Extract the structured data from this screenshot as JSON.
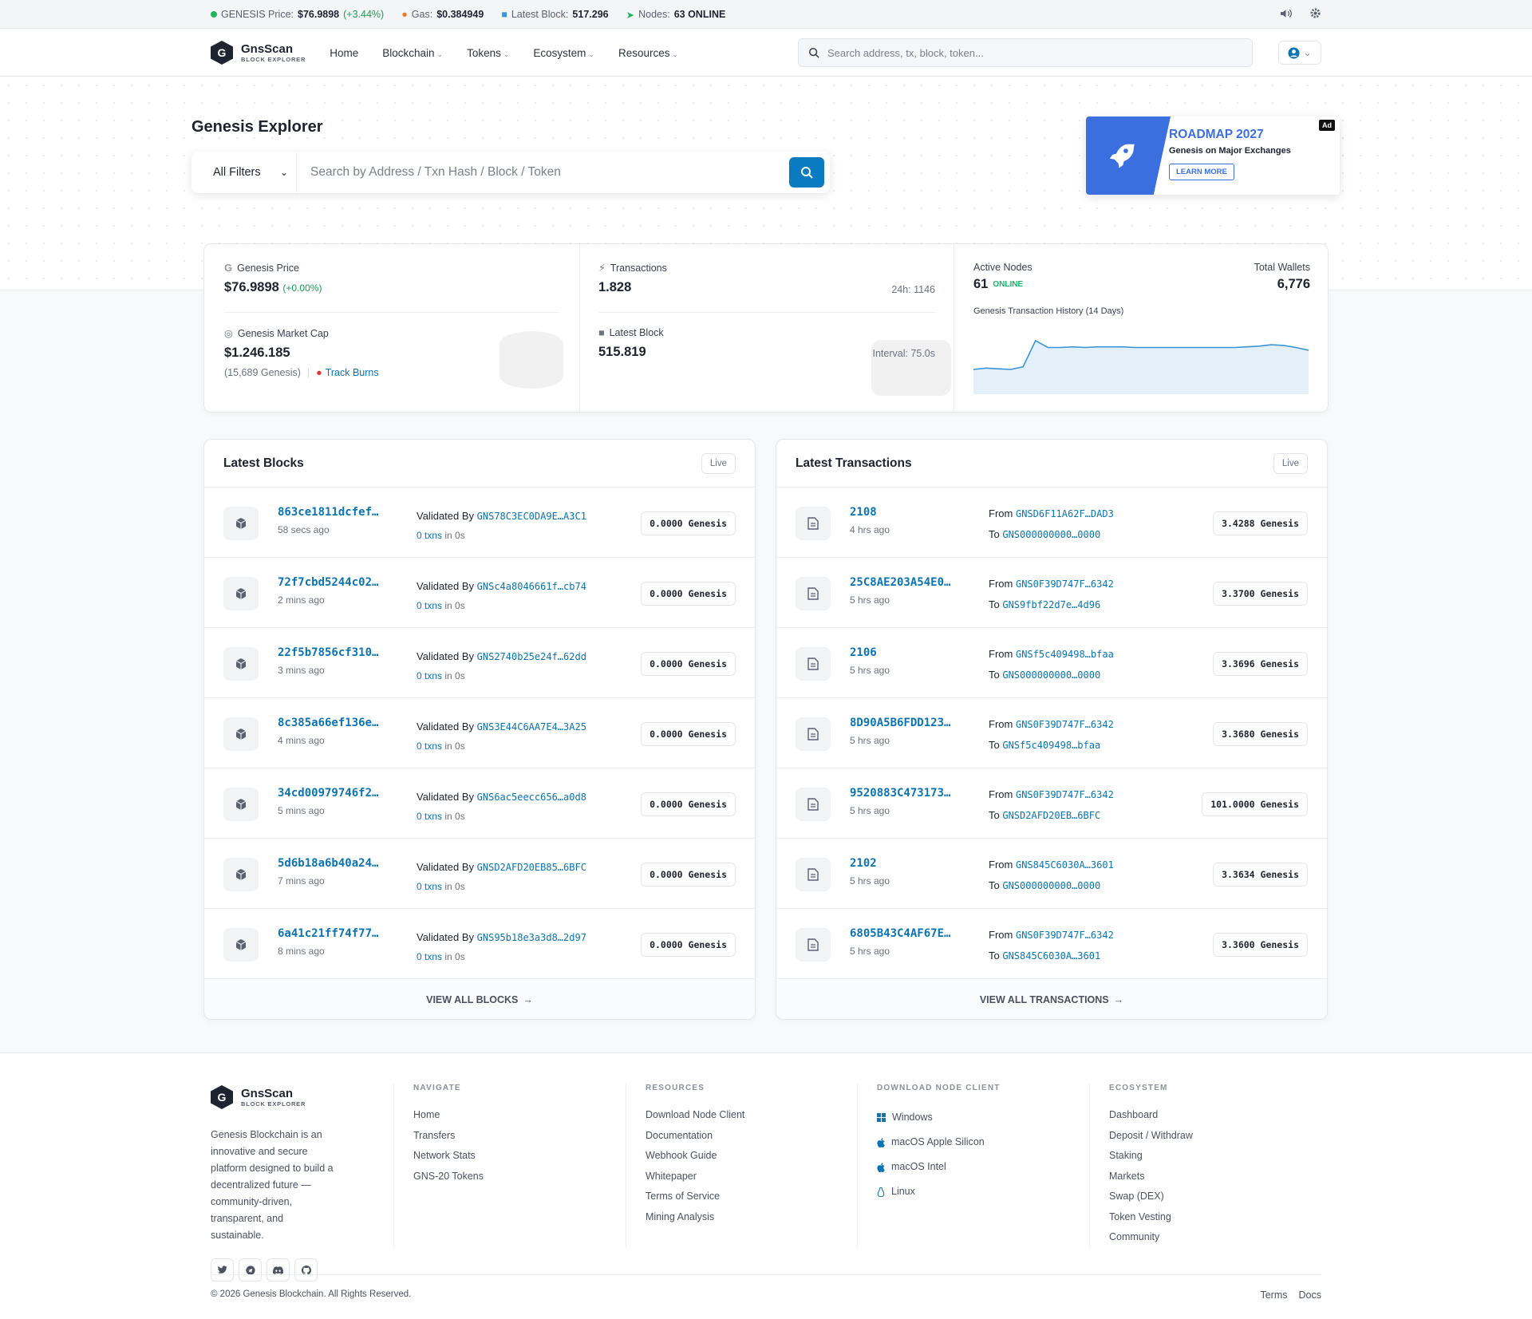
{
  "ticker": {
    "price_label": "GENESIS Price:",
    "price": "$76.9898",
    "price_change": "(+3.44%)",
    "gas_label": "Gas:",
    "gas": "$0.384949",
    "block_label": "Latest Block:",
    "block": "517.296",
    "nodes_label": "Nodes:",
    "nodes": "63 ONLINE"
  },
  "nav": {
    "brand": "GnsScan",
    "brand_sub": "BLOCK EXPLORER",
    "logo_letter": "G",
    "menu": [
      "Home",
      "Blockchain",
      "Tokens",
      "Ecosystem",
      "Resources"
    ],
    "search_placeholder": "Search address, tx, block, token..."
  },
  "hero": {
    "title": "Genesis Explorer",
    "filter": "All Filters",
    "search_placeholder": "Search by Address / Txn Hash / Block / Token"
  },
  "ad": {
    "title": "ROADMAP 2027",
    "subtitle": "Genesis on Major Exchanges",
    "button": "LEARN MORE",
    "tag": "Ad"
  },
  "stats": {
    "price_label": "Genesis Price",
    "price": "$76.9898",
    "price_change": "(+0.00%)",
    "mcap_label": "Genesis Market Cap",
    "mcap": "$1.246.185",
    "mcap_sub": "(15,689 Genesis)",
    "track_burns": "Track Burns",
    "tx_label": "Transactions",
    "tx": "1.828",
    "tx_24h": "24h: 1146",
    "block_label": "Latest Block",
    "block": "515.819",
    "interval": "Interval: 75.0s",
    "nodes_label": "Active Nodes",
    "nodes": "61",
    "nodes_status": "ONLINE",
    "wallets_label": "Total Wallets",
    "wallets": "6,776",
    "history_label": "Genesis Transaction History (14 Days)"
  },
  "chart_data": {
    "type": "area",
    "title": "Genesis Transaction History (14 Days)",
    "x": [
      1,
      2,
      3,
      4,
      5,
      6,
      7,
      8,
      9,
      10,
      11,
      12,
      13,
      14,
      15,
      16,
      17,
      18,
      19,
      20,
      21,
      22,
      23,
      24,
      25,
      26,
      27,
      28
    ],
    "values": [
      36,
      38,
      37,
      36,
      40,
      78,
      68,
      68,
      69,
      68,
      69,
      69,
      69,
      68,
      68,
      68,
      68,
      68,
      68,
      68,
      68,
      68,
      69,
      70,
      72,
      71,
      68,
      64
    ],
    "ylim": [
      0,
      100
    ],
    "grid": false,
    "legend": "none"
  },
  "blocks": {
    "title": "Latest Blocks",
    "live": "Live",
    "validated_by": "Validated By",
    "txns_suffix": "in 0s",
    "footer": "VIEW ALL BLOCKS",
    "rows": [
      {
        "hash": "863ce1811dcfef…",
        "time": "58 secs ago",
        "validator": "GNS78C3EC0DA9E…A3C1",
        "txns": "0 txns",
        "amount": "0.0000 Genesis"
      },
      {
        "hash": "72f7cbd5244c02…",
        "time": "2 mins ago",
        "validator": "GNSc4a8046661f…cb74",
        "txns": "0 txns",
        "amount": "0.0000 Genesis"
      },
      {
        "hash": "22f5b7856cf310…",
        "time": "3 mins ago",
        "validator": "GNS2740b25e24f…62dd",
        "txns": "0 txns",
        "amount": "0.0000 Genesis"
      },
      {
        "hash": "8c385a66ef136e…",
        "time": "4 mins ago",
        "validator": "GNS3E44C6AA7E4…3A25",
        "txns": "0 txns",
        "amount": "0.0000 Genesis"
      },
      {
        "hash": "34cd00979746f2…",
        "time": "5 mins ago",
        "validator": "GNS6ac5eecc656…a0d8",
        "txns": "0 txns",
        "amount": "0.0000 Genesis"
      },
      {
        "hash": "5d6b18a6b40a24…",
        "time": "7 mins ago",
        "validator": "GNSD2AFD20EB85…6BFC",
        "txns": "0 txns",
        "amount": "0.0000 Genesis"
      },
      {
        "hash": "6a41c21ff74f77…",
        "time": "8 mins ago",
        "validator": "GNS95b18e3a3d8…2d97",
        "txns": "0 txns",
        "amount": "0.0000 Genesis"
      }
    ]
  },
  "transactions": {
    "title": "Latest Transactions",
    "live": "Live",
    "from_label": "From",
    "to_label": "To",
    "footer": "VIEW ALL TRANSACTIONS",
    "rows": [
      {
        "hash": "2108",
        "time": "4 hrs ago",
        "from": "GNSD6F11A62F…DAD3",
        "to": "GNS000000000…0000",
        "amount": "3.4288 Genesis"
      },
      {
        "hash": "25C8AE203A54E0…",
        "time": "5 hrs ago",
        "from": "GNS0F39D747F…6342",
        "to": "GNS9fbf22d7e…4d96",
        "amount": "3.3700 Genesis"
      },
      {
        "hash": "2106",
        "time": "5 hrs ago",
        "from": "GNSf5c409498…bfaa",
        "to": "GNS000000000…0000",
        "amount": "3.3696 Genesis"
      },
      {
        "hash": "8D90A5B6FDD123…",
        "time": "5 hrs ago",
        "from": "GNS0F39D747F…6342",
        "to": "GNSf5c409498…bfaa",
        "amount": "3.3680 Genesis"
      },
      {
        "hash": "9520883C473173…",
        "time": "5 hrs ago",
        "from": "GNS0F39D747F…6342",
        "to": "GNSD2AFD20EB…6BFC",
        "amount": "101.0000 Genesis"
      },
      {
        "hash": "2102",
        "time": "5 hrs ago",
        "from": "GNS845C6030A…3601",
        "to": "GNS000000000…0000",
        "amount": "3.3634 Genesis"
      },
      {
        "hash": "6805B43C4AF67E…",
        "time": "5 hrs ago",
        "from": "GNS0F39D747F…6342",
        "to": "GNS845C6030A…3601",
        "amount": "3.3600 Genesis"
      }
    ]
  },
  "footer": {
    "brand": "GnsScan",
    "brand_sub": "BLOCK EXPLORER",
    "description": "Genesis Blockchain is an innovative and secure platform designed to build a decentralized future — community-driven, transparent, and sustainable.",
    "navigate_head": "NAVIGATE",
    "navigate": [
      "Home",
      "Transfers",
      "Network Stats",
      "GNS-20 Tokens"
    ],
    "resources_head": "RESOURCES",
    "resources": [
      "Download Node Client",
      "Documentation",
      "Webhook Guide",
      "Whitepaper",
      "Terms of Service",
      "Mining Analysis"
    ],
    "download_head": "DOWNLOAD NODE CLIENT",
    "download": [
      "Windows",
      "macOS Apple Silicon",
      "macOS Intel",
      "Linux"
    ],
    "ecosystem_head": "ECOSYSTEM",
    "ecosystem": [
      "Dashboard",
      "Deposit / Withdraw",
      "Staking",
      "Markets",
      "Swap (DEX)",
      "Token Vesting",
      "Community"
    ],
    "copyright": "© 2026 Genesis Blockchain. All Rights Reserved.",
    "bottom_links": [
      "Terms",
      "Docs"
    ]
  },
  "colors": {
    "accent": "#0a74b5",
    "positive": "#1b9e55",
    "ad_blue": "#3b6fe0",
    "chart_line": "#3a94d6",
    "chart_fill": "#e3f0fa"
  }
}
